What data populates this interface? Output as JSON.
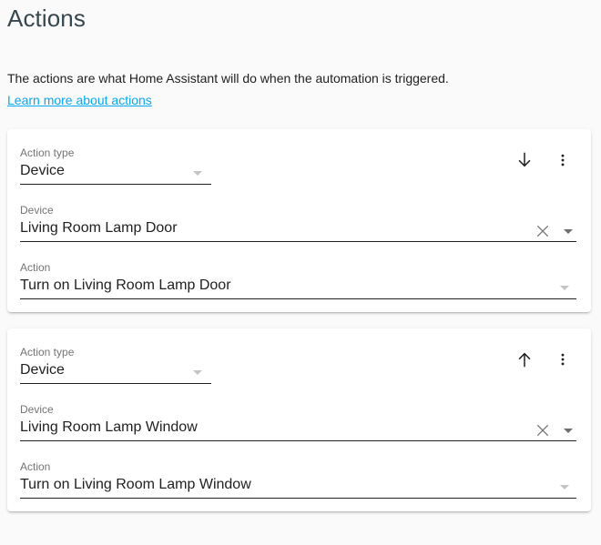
{
  "page": {
    "title": "Actions",
    "description": "The actions are what Home Assistant will do when the automation is triggered.",
    "learn_more_label": "Learn more about actions",
    "link_color": "#03a9f4",
    "background_color": "#fafafa",
    "card_background_color": "#ffffff",
    "label_color": "#757575",
    "value_color": "#212121"
  },
  "cards": [
    {
      "move_icon": "arrow-down-icon",
      "menu_icon": "overflow-menu-icon",
      "action_type": {
        "label": "Action type",
        "value": "Device",
        "dropdown_icon": "chevron-down-icon"
      },
      "device": {
        "label": "Device",
        "value": "Living Room Lamp Door",
        "clear_icon": "close-icon",
        "dropdown_icon": "chevron-down-icon"
      },
      "action": {
        "label": "Action",
        "value": "Turn on Living Room Lamp Door",
        "dropdown_icon": "chevron-down-icon"
      }
    },
    {
      "move_icon": "arrow-up-icon",
      "menu_icon": "overflow-menu-icon",
      "action_type": {
        "label": "Action type",
        "value": "Device",
        "dropdown_icon": "chevron-down-icon"
      },
      "device": {
        "label": "Device",
        "value": "Living Room Lamp Window",
        "clear_icon": "close-icon",
        "dropdown_icon": "chevron-down-icon"
      },
      "action": {
        "label": "Action",
        "value": "Turn on Living Room Lamp Window",
        "dropdown_icon": "chevron-down-icon"
      }
    }
  ]
}
